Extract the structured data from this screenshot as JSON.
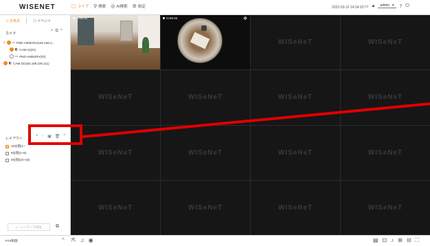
{
  "topbar": {
    "logo": "WISENET",
    "menu": [
      {
        "icon": "live-icon",
        "label": "ライブ",
        "active": true
      },
      {
        "icon": "search-icon",
        "label": "検索"
      },
      {
        "icon": "ai-search-icon",
        "label": "AI検索"
      },
      {
        "icon": "settings-icon",
        "label": "設定"
      }
    ],
    "datetime": "2022-03-10 14:34:32",
    "user": "admin"
  },
  "sidebar": {
    "tabs": [
      {
        "icon": "bookmark-icon",
        "label": "お気本",
        "active": true
      },
      {
        "icon": "event-icon",
        "label": "イベント"
      }
    ],
    "camera_section": "カメラ",
    "tree": [
      {
        "label": "PND-A9081RV(192.168.1...",
        "level": 0,
        "status": "orange"
      },
      {
        "label": "CAM 01(#1)",
        "level": 1,
        "status": "orange"
      },
      {
        "label": "PND-A9081RV(#2)",
        "level": 1,
        "status": "hollow"
      },
      {
        "label": "CAM 02(192.168.100.111)",
        "level": 0,
        "status": "orange"
      }
    ],
    "layout_section": "レイアウト",
    "layouts": [
      {
        "label": "16分割(1~",
        "active": true
      },
      {
        "label": "9分割(1~9)"
      },
      {
        "label": "9分割(10~18)"
      }
    ],
    "sequence_button": "シーケンス再生"
  },
  "grid": {
    "watermark": "WISeNeT",
    "cells": [
      {
        "label": "CAM 01",
        "type": "cam1"
      },
      {
        "label": "CAM 02",
        "type": "cam2"
      },
      {
        "type": "empty"
      },
      {
        "type": "empty"
      },
      {
        "type": "empty"
      },
      {
        "type": "empty"
      },
      {
        "type": "empty"
      },
      {
        "type": "empty"
      },
      {
        "type": "empty"
      },
      {
        "type": "empty"
      },
      {
        "type": "empty"
      },
      {
        "type": "empty"
      },
      {
        "type": "empty"
      },
      {
        "type": "empty"
      },
      {
        "type": "empty"
      },
      {
        "type": "empty"
      }
    ]
  },
  "bottombar": {
    "ptz_label": "PTZ制御"
  },
  "colors": {
    "accent": "#f08a1c",
    "annotation": "#e00000"
  }
}
